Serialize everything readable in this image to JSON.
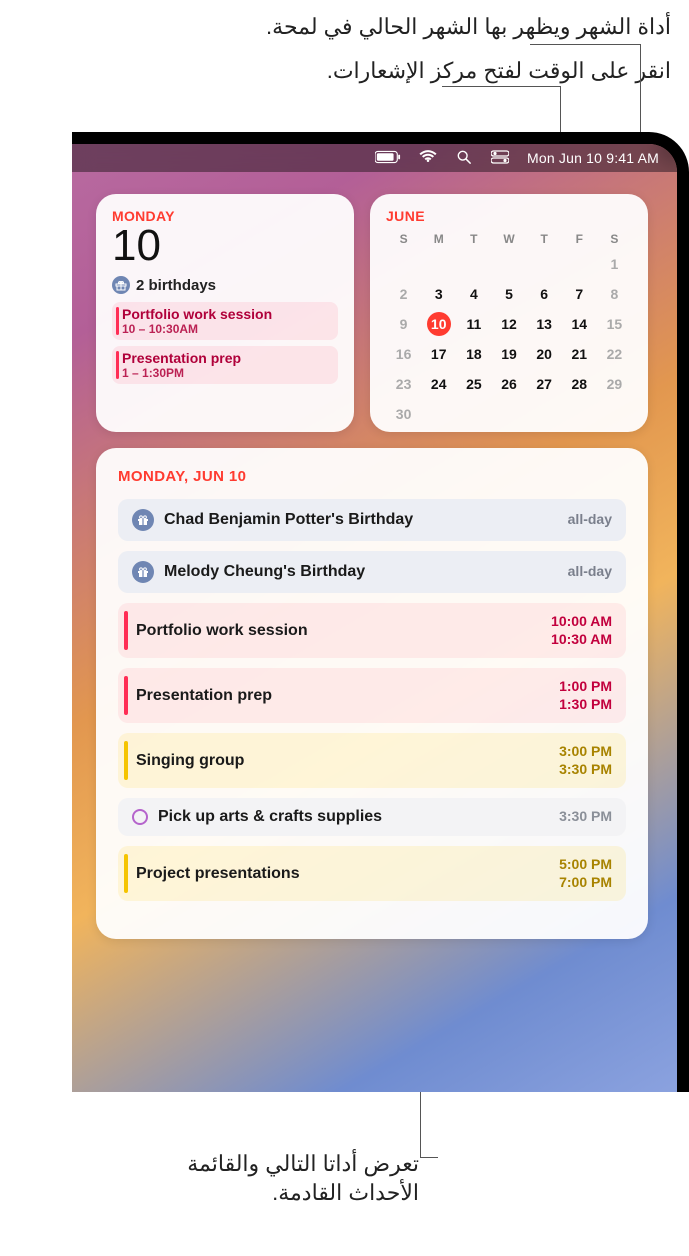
{
  "callouts": {
    "top1": "أداة الشهر ويظهر بها الشهر الحالي في لمحة.",
    "top2": "انقر على الوقت لفتح مركز الإشعارات.",
    "bottom_l1": "تعرض أداتا التالي والقائمة",
    "bottom_l2": "الأحداث القادمة."
  },
  "menubar": {
    "clock": "Mon Jun 10  9:41 AM"
  },
  "today_widget": {
    "day_label": "MONDAY",
    "day_num": "10",
    "birthdays_text": "2 birthdays",
    "events": [
      {
        "title": "Portfolio work session",
        "time": "10 – 10:30AM"
      },
      {
        "title": "Presentation prep",
        "time": "1 – 1:30PM"
      }
    ]
  },
  "month_widget": {
    "title": "JUNE",
    "dow": [
      "S",
      "M",
      "T",
      "W",
      "T",
      "F",
      "S"
    ],
    "weeks": [
      [
        {
          "n": "",
          "out": true
        },
        {
          "n": "",
          "out": true
        },
        {
          "n": "",
          "out": true
        },
        {
          "n": "",
          "out": true
        },
        {
          "n": "",
          "out": true
        },
        {
          "n": "",
          "out": true
        },
        {
          "n": "1",
          "wk": true
        }
      ],
      [
        {
          "n": "2",
          "wk": true
        },
        {
          "n": "3"
        },
        {
          "n": "4"
        },
        {
          "n": "5"
        },
        {
          "n": "6"
        },
        {
          "n": "7"
        },
        {
          "n": "8",
          "wk": true
        }
      ],
      [
        {
          "n": "9",
          "wk": true
        },
        {
          "n": "10",
          "today": true
        },
        {
          "n": "11"
        },
        {
          "n": "12"
        },
        {
          "n": "13"
        },
        {
          "n": "14"
        },
        {
          "n": "15",
          "wk": true
        }
      ],
      [
        {
          "n": "16",
          "wk": true
        },
        {
          "n": "17"
        },
        {
          "n": "18"
        },
        {
          "n": "19"
        },
        {
          "n": "20"
        },
        {
          "n": "21"
        },
        {
          "n": "22",
          "wk": true
        }
      ],
      [
        {
          "n": "23",
          "wk": true
        },
        {
          "n": "24"
        },
        {
          "n": "25"
        },
        {
          "n": "26"
        },
        {
          "n": "27"
        },
        {
          "n": "28"
        },
        {
          "n": "29",
          "wk": true
        }
      ],
      [
        {
          "n": "30",
          "wk": true
        },
        {
          "n": ""
        },
        {
          "n": ""
        },
        {
          "n": ""
        },
        {
          "n": ""
        },
        {
          "n": ""
        },
        {
          "n": ""
        }
      ]
    ]
  },
  "upnext": {
    "header": "MONDAY, JUN 10",
    "events": [
      {
        "kind": "birthday",
        "title": "Chad Benjamin Potter's Birthday",
        "time1": "all-day"
      },
      {
        "kind": "birthday",
        "title": "Melody Cheung's Birthday",
        "time1": "all-day"
      },
      {
        "kind": "red",
        "title": "Portfolio work session",
        "time1": "10:00 AM",
        "time2": "10:30 AM"
      },
      {
        "kind": "red",
        "title": "Presentation prep",
        "time1": "1:00 PM",
        "time2": "1:30 PM"
      },
      {
        "kind": "yellow",
        "title": "Singing group",
        "time1": "3:00 PM",
        "time2": "3:30 PM"
      },
      {
        "kind": "reminder",
        "title": "Pick up arts & crafts supplies",
        "time1": "3:30 PM"
      },
      {
        "kind": "yellow",
        "title": "Project presentations",
        "time1": "5:00 PM",
        "time2": "7:00 PM"
      }
    ]
  }
}
